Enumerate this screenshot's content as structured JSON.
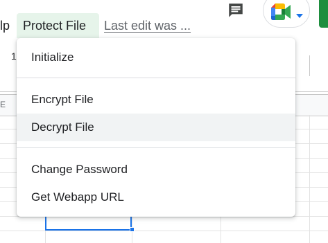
{
  "menubar": {
    "help_label": "lp",
    "protect_label": "Protect File",
    "last_edit": "Last edit was ..."
  },
  "toolbar": {
    "digit": "1"
  },
  "sheet": {
    "col_label": "E"
  },
  "dropdown": {
    "items": [
      {
        "label": "Initialize"
      },
      {
        "label": "Encrypt File"
      },
      {
        "label": "Decrypt File",
        "highlighted": true
      },
      {
        "label": "Change Password"
      },
      {
        "label": "Get Webapp URL"
      }
    ]
  },
  "icons": {
    "comment": "comment-icon",
    "meet": "google-meet-icon",
    "caret": "caret-down-icon"
  },
  "colors": {
    "menu_active_bg": "#e6f4ea",
    "item_hover_bg": "#f1f3f4",
    "selection": "#1a73e8",
    "share_green": "#1e8e3e"
  }
}
